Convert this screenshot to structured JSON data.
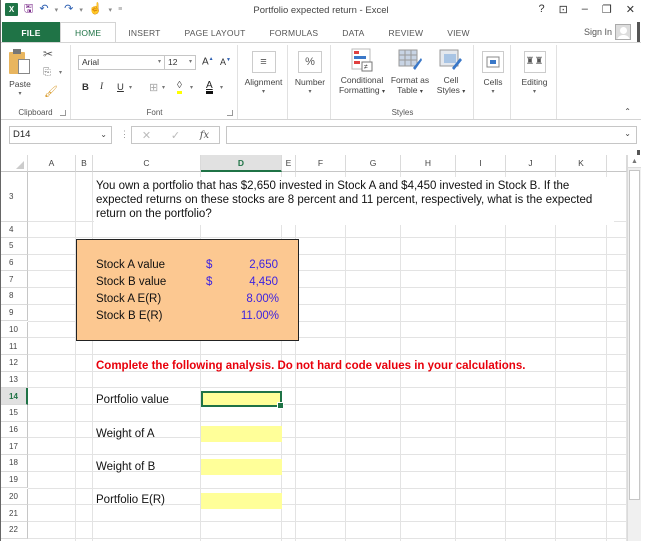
{
  "window": {
    "title": "Portfolio expected return - Excel",
    "controls": {
      "help": "?",
      "ribbon_display": "⊡",
      "minimize": "–",
      "restore": "🗗",
      "close": "✕"
    }
  },
  "qat": {
    "app_icon": "X",
    "save_icon": "save-icon",
    "undo_icon": "undo-icon",
    "redo_icon": "redo-icon",
    "touch_icon": "touch-mode-icon"
  },
  "tabs": [
    {
      "label": "FILE"
    },
    {
      "label": "HOME"
    },
    {
      "label": "INSERT"
    },
    {
      "label": "PAGE LAYOUT"
    },
    {
      "label": "FORMULAS"
    },
    {
      "label": "DATA"
    },
    {
      "label": "REVIEW"
    },
    {
      "label": "VIEW"
    }
  ],
  "active_tab": "HOME",
  "signin": {
    "label": "Sign In"
  },
  "ribbon": {
    "clipboard": {
      "label": "Clipboard",
      "paste": "Paste"
    },
    "font": {
      "label": "Font",
      "font_name": "Arial",
      "font_size": "12",
      "grow": "A",
      "shrink": "A",
      "bold": "B",
      "italic": "I",
      "underline": "U"
    },
    "alignment": {
      "label": "Alignment"
    },
    "number": {
      "label": "Number",
      "icon_glyph": "%"
    },
    "styles": {
      "label": "Styles",
      "conditional_formatting": [
        "Conditional",
        "Formatting"
      ],
      "format_as_table": [
        "Format as",
        "Table"
      ],
      "cell_styles": [
        "Cell",
        "Styles"
      ]
    },
    "cells": {
      "label": "Cells"
    },
    "editing": {
      "label": "Editing"
    }
  },
  "formula_bar": {
    "name_box": "D14",
    "cancel": "✕",
    "enter": "✓",
    "fx": "fx",
    "value": ""
  },
  "sheet": {
    "columns": [
      "A",
      "B",
      "C",
      "D",
      "E",
      "F",
      "G",
      "H",
      "I",
      "J",
      "K"
    ],
    "selected_column": "D",
    "rows": [
      "3",
      "4",
      "5",
      "6",
      "7",
      "8",
      "9",
      "10",
      "11",
      "12",
      "13",
      "14",
      "15",
      "16",
      "17",
      "18",
      "19",
      "20",
      "21",
      "22"
    ],
    "selected_row": "14",
    "question": "You own a portfolio that has $2,650 invested in Stock A and $4,450 invested in Stock B. If the expected returns on these stocks are 8 percent and 11 percent, respectively, what is the expected return on the portfolio?",
    "inputs": [
      {
        "label": "Stock A value",
        "currency": "$",
        "value": "2,650"
      },
      {
        "label": "Stock B value",
        "currency": "$",
        "value": "4,450"
      },
      {
        "label": "Stock A E(R)",
        "currency": "",
        "value": "8.00%"
      },
      {
        "label": "Stock B E(R)",
        "currency": "",
        "value": "11.00%"
      }
    ],
    "instruction": "Complete the following analysis. Do not hard code values in your calculations.",
    "analysis": [
      {
        "label": "Portfolio value",
        "value": ""
      },
      {
        "label": "Weight of A",
        "value": ""
      },
      {
        "label": "Weight of B",
        "value": ""
      },
      {
        "label": "Portfolio E(R)",
        "value": ""
      }
    ]
  },
  "colors": {
    "excel_green": "#1f7346",
    "input_box_fill": "#fcc891",
    "input_value_blue": "#3d22e0",
    "instruction_red": "#e8000b",
    "answer_cell_yellow": "#ffff99"
  }
}
